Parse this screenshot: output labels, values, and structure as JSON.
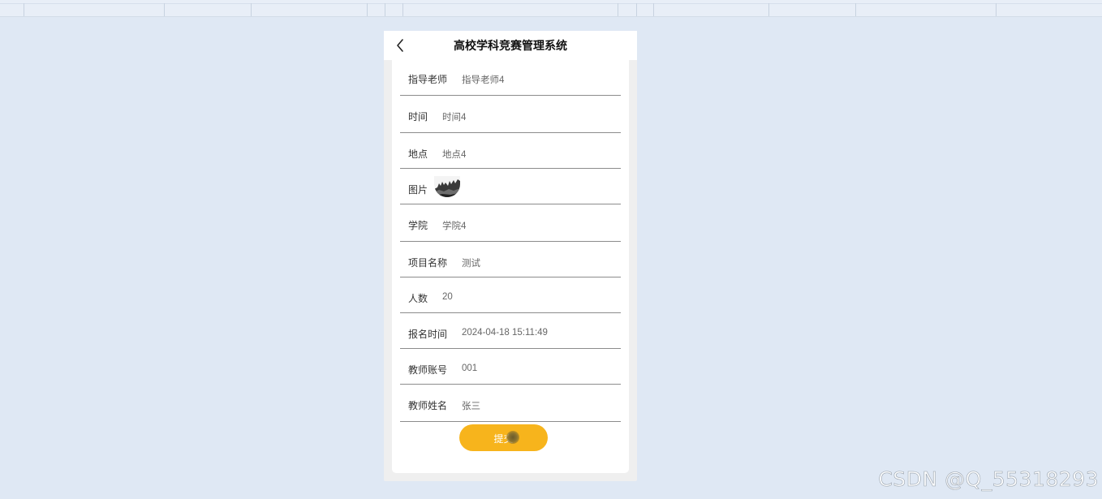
{
  "header": {
    "title": "高校学科竞赛管理系统",
    "back_icon": "chevron-left-icon"
  },
  "form": {
    "fields": [
      {
        "label": "指导老师",
        "value": "指导老师4"
      },
      {
        "label": "时间",
        "value": "时间4"
      },
      {
        "label": "地点",
        "value": "地点4"
      },
      {
        "label": "图片",
        "value": ""
      },
      {
        "label": "学院",
        "value": "学院4"
      },
      {
        "label": "项目名称",
        "value": "测试"
      },
      {
        "label": "人数",
        "value": "20"
      },
      {
        "label": "报名时间",
        "value": "2024-04-18 15:11:49"
      },
      {
        "label": "教师账号",
        "value": "001"
      },
      {
        "label": "教师姓名",
        "value": "张三"
      }
    ],
    "submit_label": "提交"
  },
  "colors": {
    "page_bg": "#dfe8f4",
    "panel_bg": "#efefef",
    "card_bg": "#ffffff",
    "accent": "#f7b41c",
    "divider": "#8c8c8c"
  },
  "watermark": "CSDN @Q_55318293"
}
